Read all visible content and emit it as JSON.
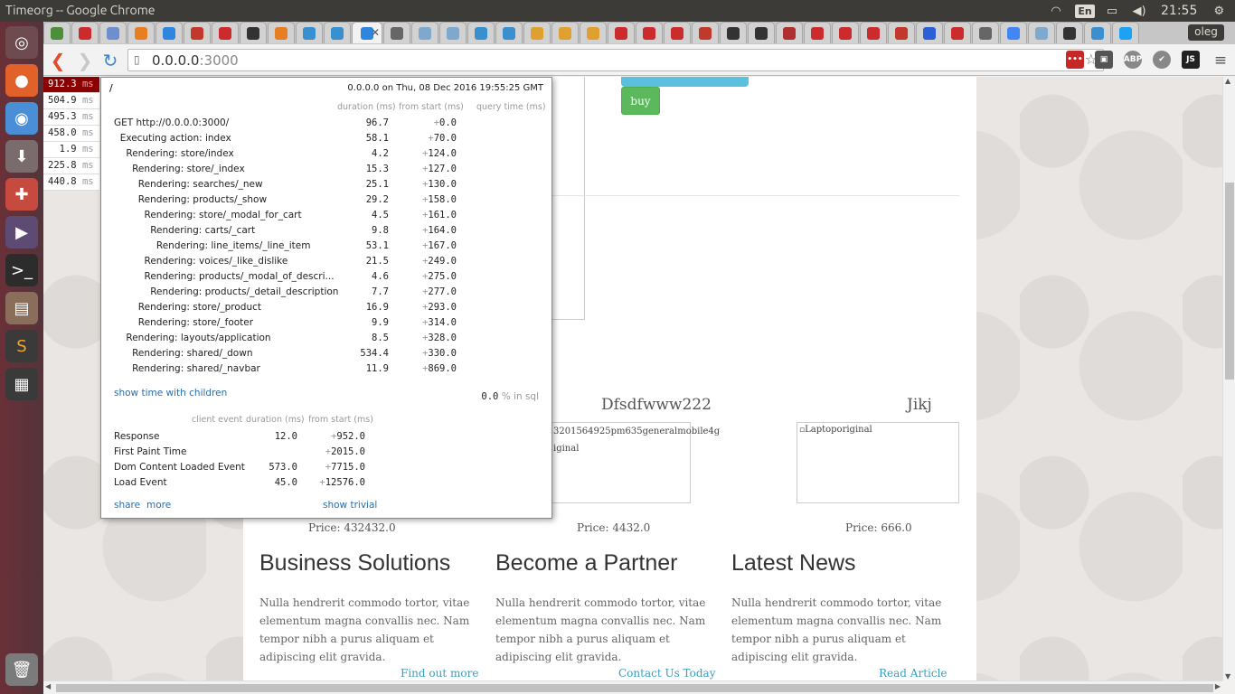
{
  "window": {
    "title": "Timeorg -- Google Chrome"
  },
  "panel": {
    "language": "En",
    "clock": "21:55",
    "user": "oleg"
  },
  "browser": {
    "url_host": "0.0.0.0",
    "url_port": ":3000",
    "extensions": [
      "ABP",
      "JS"
    ]
  },
  "profiler": {
    "buttons": [
      {
        "value": "912.3",
        "unit": "ms"
      },
      {
        "value": "504.9",
        "unit": "ms"
      },
      {
        "value": "495.3",
        "unit": "ms"
      },
      {
        "value": "458.0",
        "unit": "ms"
      },
      {
        "value": "1.9",
        "unit": "ms"
      },
      {
        "value": "225.8",
        "unit": "ms"
      },
      {
        "value": "440.8",
        "unit": "ms"
      }
    ],
    "path": "/",
    "server_info": "0.0.0.0 on Thu, 08 Dec 2016 19:55:25 GMT",
    "headers": {
      "duration": "duration (ms)",
      "from_start": "from start (ms)",
      "query_time": "query time (ms)"
    },
    "timings": [
      {
        "name": "GET http://0.0.0.0:3000/",
        "duration": "96.7",
        "from_start": "0.0",
        "indent": 0
      },
      {
        "name": "Executing action: index",
        "duration": "58.1",
        "from_start": "70.0",
        "indent": 1
      },
      {
        "name": "Rendering: store/index",
        "duration": "4.2",
        "from_start": "124.0",
        "indent": 2
      },
      {
        "name": "Rendering: store/_index",
        "duration": "15.3",
        "from_start": "127.0",
        "indent": 3
      },
      {
        "name": "Rendering: searches/_new",
        "duration": "25.1",
        "from_start": "130.0",
        "indent": 4
      },
      {
        "name": "Rendering: products/_show",
        "duration": "29.2",
        "from_start": "158.0",
        "indent": 4
      },
      {
        "name": "Rendering: store/_modal_for_cart",
        "duration": "4.5",
        "from_start": "161.0",
        "indent": 5
      },
      {
        "name": "Rendering: carts/_cart",
        "duration": "9.8",
        "from_start": "164.0",
        "indent": 6
      },
      {
        "name": "Rendering: line_items/_line_item",
        "duration": "53.1",
        "from_start": "167.0",
        "indent": 7
      },
      {
        "name": "Rendering: voices/_like_dislike",
        "duration": "21.5",
        "from_start": "249.0",
        "indent": 5
      },
      {
        "name": "Rendering: products/_modal_of_descri...",
        "duration": "4.6",
        "from_start": "275.0",
        "indent": 5
      },
      {
        "name": "Rendering: products/_detail_description",
        "duration": "7.7",
        "from_start": "277.0",
        "indent": 6
      },
      {
        "name": "Rendering: store/_product",
        "duration": "16.9",
        "from_start": "293.0",
        "indent": 4
      },
      {
        "name": "Rendering: store/_footer",
        "duration": "9.9",
        "from_start": "314.0",
        "indent": 4
      },
      {
        "name": "Rendering: layouts/application",
        "duration": "8.5",
        "from_start": "328.0",
        "indent": 2
      },
      {
        "name": "Rendering: shared/_down",
        "duration": "534.4",
        "from_start": "330.0",
        "indent": 3
      },
      {
        "name": "Rendering: shared/_navbar",
        "duration": "11.9",
        "from_start": "869.0",
        "indent": 3
      }
    ],
    "show_children_label": "show time with children",
    "sql_value": "0.0",
    "sql_label": "% in sql",
    "client_headers": {
      "event": "client event",
      "duration": "duration (ms)",
      "from_start": "from start (ms)"
    },
    "client_events": [
      {
        "name": "Response",
        "duration": "12.0",
        "from_start": "952.0"
      },
      {
        "name": "First Paint Time",
        "duration": "",
        "from_start": "2015.0"
      },
      {
        "name": "Dom Content Loaded Event",
        "duration": "573.0",
        "from_start": "7715.0"
      },
      {
        "name": "Load Event",
        "duration": "45.0",
        "from_start": "12576.0"
      }
    ],
    "share_label": "share",
    "more_label": "more",
    "trivial_label": "show trivial"
  },
  "page": {
    "buy_label": "buy",
    "products": [
      {
        "title": "",
        "img_alt": "",
        "price": "Price: 432432.0"
      },
      {
        "title": "Dfsdfwww222",
        "img_alt": "3201564925pm635generalmobile4g",
        "img_alt2": "iginal",
        "price": "Price: 4432.0"
      },
      {
        "title": "Jikj",
        "img_alt": "Laptoporiginal",
        "price": "Price: 666.0"
      }
    ],
    "columns": [
      {
        "title": "Business Solutions",
        "text": "Nulla hendrerit commodo tortor, vitae elementum magna convallis nec. Nam tempor nibh a purus aliquam et adipiscing elit gravida.",
        "link": "Find out more"
      },
      {
        "title": "Become a Partner",
        "text": "Nulla hendrerit commodo tortor, vitae elementum magna convallis nec. Nam tempor nibh a purus aliquam et adipiscing elit gravida.",
        "link": "Contact Us Today"
      },
      {
        "title": "Latest News",
        "text": "Nulla hendrerit commodo tortor, vitae elementum magna convallis nec. Nam tempor nibh a purus aliquam et adipiscing elit gravida.",
        "link": "Read Article"
      }
    ]
  },
  "colors": {
    "accent_buy": "#5cb85c",
    "accent_info": "#5bc0de",
    "profiler_hot": "#8b0000",
    "link": "#3a9ec2"
  }
}
